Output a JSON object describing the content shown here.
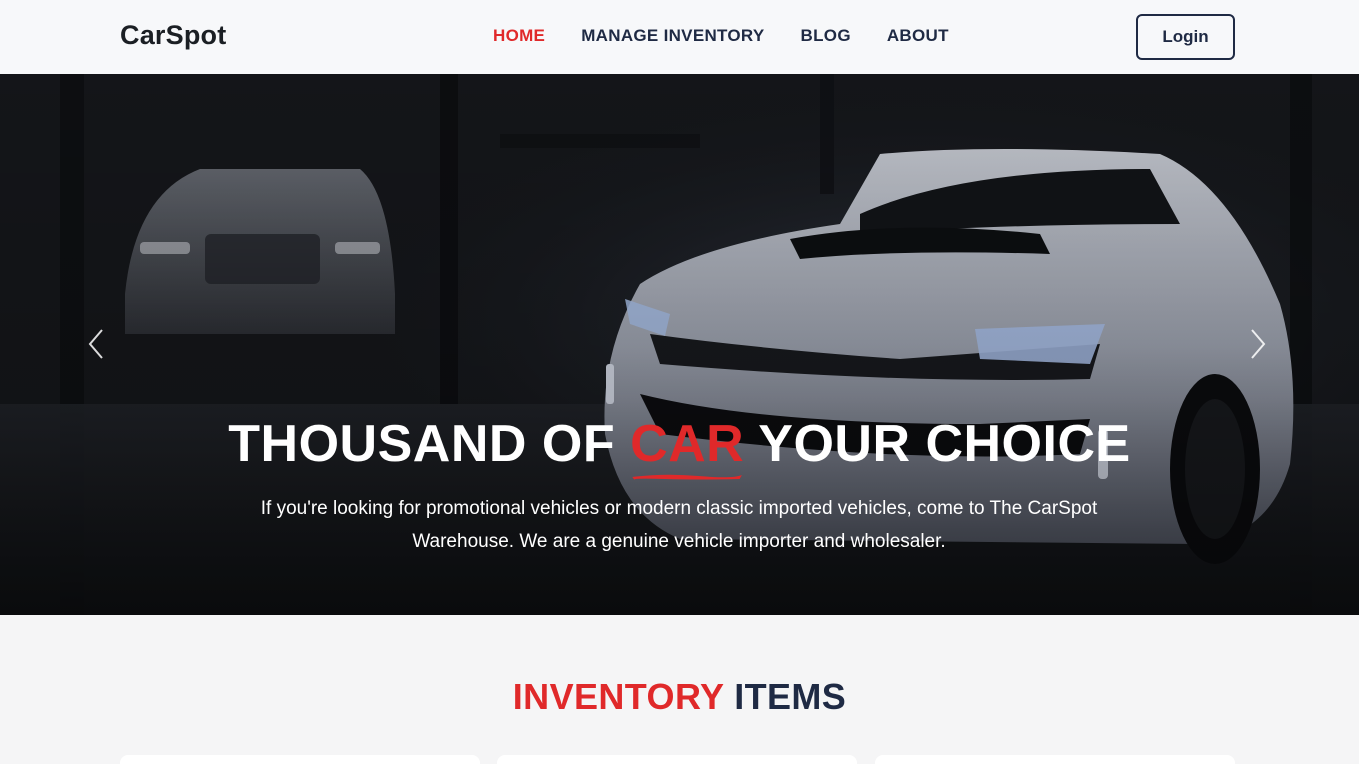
{
  "header": {
    "logo": "CarSpot",
    "nav": [
      "HOME",
      "MANAGE INVENTORY",
      "BLOG",
      "ABOUT"
    ],
    "active_nav": "HOME",
    "login_label": "Login"
  },
  "hero": {
    "title_part1": "THOUSAND OF",
    "title_accent": "CAR",
    "title_part2": "YOUR CHOICE",
    "subtitle": "If you're looking for promotional vehicles or modern classic imported vehicles, come to The CarSpot Warehouse. We are a genuine vehicle importer and wholesaler.",
    "prev_icon": "chevron-left-icon",
    "next_icon": "chevron-right-icon"
  },
  "inventory": {
    "title_red": "INVENTORY",
    "title_dark": "ITEMS"
  },
  "colors": {
    "accent": "#e0292a",
    "navy": "#1f2a44",
    "header_bg": "#f7f8fa",
    "page_bg": "#f5f5f6"
  }
}
